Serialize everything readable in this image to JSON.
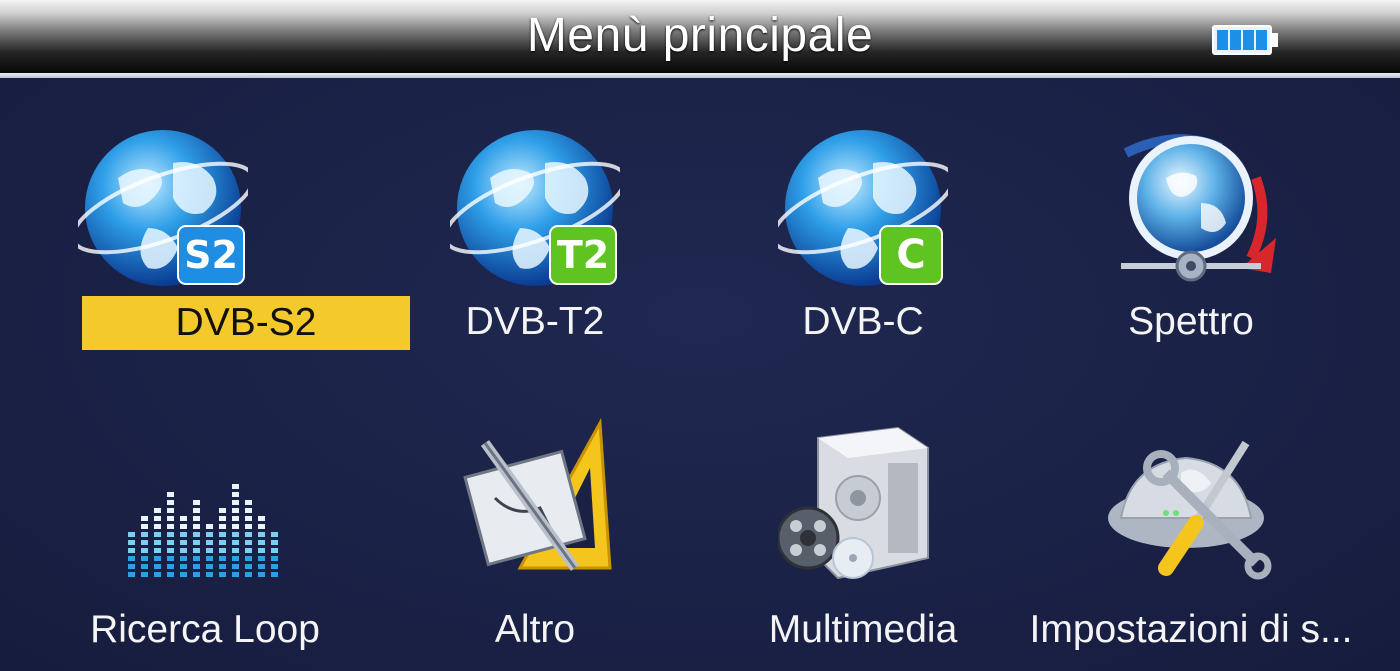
{
  "header": {
    "title": "Menù principale",
    "battery_icon": "battery-full-icon"
  },
  "menu": {
    "items": [
      {
        "label": "DVB-S2",
        "icon": "globe-s2-icon",
        "badge": "S2",
        "badge_color": "#1f8de2",
        "selected": true
      },
      {
        "label": "DVB-T2",
        "icon": "globe-t2-icon",
        "badge": "T2",
        "badge_color": "#5fc421",
        "selected": false
      },
      {
        "label": "DVB-C",
        "icon": "globe-c-icon",
        "badge": "C",
        "badge_color": "#5fc421",
        "selected": false
      },
      {
        "label": "Spettro",
        "icon": "spectrum-globe-icon",
        "selected": false
      },
      {
        "label": "Ricerca Loop",
        "icon": "equalizer-bars-icon",
        "selected": false
      },
      {
        "label": "Altro",
        "icon": "set-square-pencil-icon",
        "selected": false
      },
      {
        "label": "Multimedia",
        "icon": "multimedia-player-icon",
        "selected": false
      },
      {
        "label": "Impostazioni di s...",
        "icon": "settings-tools-icon",
        "selected": false
      }
    ]
  },
  "colors": {
    "background": "#1a2145",
    "selection": "#f3c92c",
    "text": "#f4f4f4"
  }
}
